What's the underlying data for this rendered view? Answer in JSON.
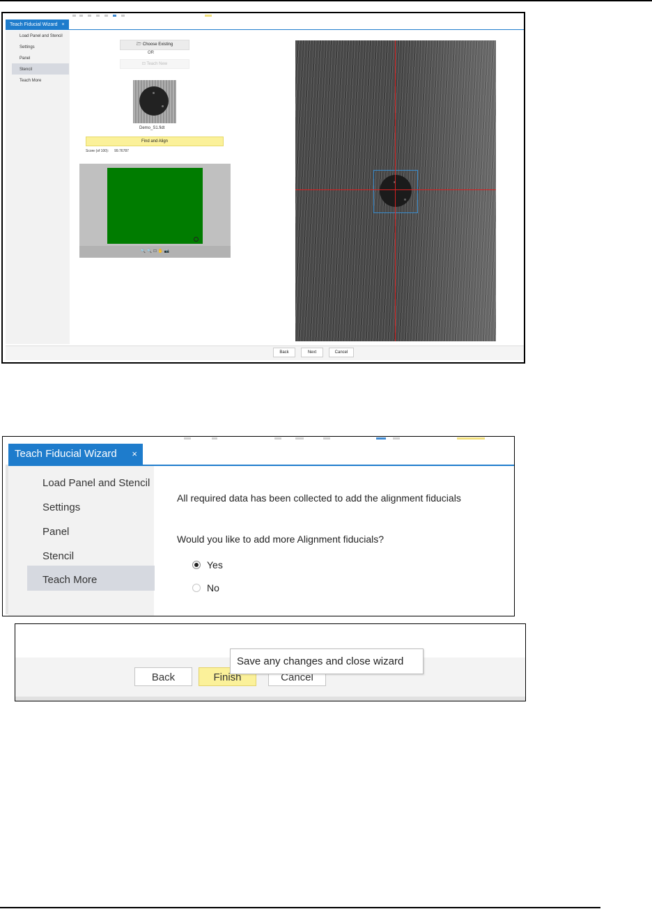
{
  "screenshot1": {
    "tab": {
      "title": "Teach Fiducial Wizard",
      "close": "×"
    },
    "sidebar": [
      "Load Panel and Stencil",
      "Settings",
      "Panel",
      "Stencil",
      "Teach More"
    ],
    "choose_existing": "Choose Existing",
    "or_label": "OR",
    "teach_new": "Teach New",
    "filename": "Demo_S1.fidt",
    "find_align": "Find and Align",
    "score_label": "Score (of 100):",
    "score_value": "99.76787",
    "view_tools": "🔍 🔍 ⊡ ✋ 📷",
    "buttons": {
      "back": "Back",
      "next": "Next",
      "cancel": "Cancel"
    }
  },
  "screenshot2": {
    "tab": {
      "title": "Teach Fiducial Wizard",
      "close": "×"
    },
    "sidebar": [
      "Load Panel and Stencil",
      "Settings",
      "Panel",
      "Stencil",
      "Teach More"
    ],
    "message": "All required data has been collected to add the alignment fiducials",
    "question": "Would you like to add more Alignment fiducials?",
    "options": [
      "Yes",
      "No"
    ],
    "selected_option": "Yes"
  },
  "screenshot3": {
    "buttons": {
      "back": "Back",
      "finish": "Finish",
      "cancel": "Cancel"
    },
    "tooltip": "Save any changes and close wizard"
  },
  "colors": {
    "tab_blue": "#1e7ccc",
    "highlight_yellow": "#fbf19a",
    "crosshair_red": "#d82020",
    "board_green": "#007c00"
  }
}
